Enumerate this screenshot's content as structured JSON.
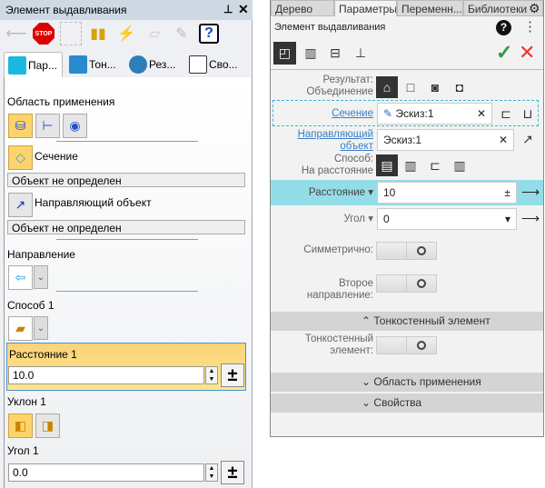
{
  "left_panel": {
    "title": "Элемент выдавливания",
    "pin": "ᵖ",
    "close": "✕",
    "toolbar": [
      "back-icon",
      "stop-icon",
      "grid-icon",
      "model-icon",
      "lightning-icon",
      "sketch-icon",
      "edit-icon",
      "help-icon"
    ],
    "stop_label": "STOP",
    "help_label": "?",
    "tabs": [
      "Пар...",
      "Тон...",
      "Рез...",
      "Сво..."
    ],
    "scope_label": "Область применения",
    "section_label": "Сечение",
    "section_value": "Объект не определен",
    "guide_label": "Направляющий объект",
    "guide_value": "Объект не определен",
    "direction_label": "Направление",
    "method_label": "Способ 1",
    "distance_label": "Расстояние 1",
    "distance_value": "10.0",
    "draft_label": "Уклон 1",
    "angle_label": "Угол 1",
    "angle_value": "0.0",
    "plusminus": "±"
  },
  "right_panel": {
    "tabs": [
      "Дерево",
      "Параметры",
      "Переменн...",
      "Библиотеки"
    ],
    "title": "Элемент выдавливания",
    "help": "?",
    "ok": "✓",
    "cancel": "✕",
    "result_label": "Результат:",
    "result_value": "Объединение",
    "section_label": "Сечение",
    "section_value": "Эскиз:1",
    "guide_label_1": "Направляющий",
    "guide_label_2": "объект",
    "guide_value": "Эскиз:1",
    "method_label": "Способ:",
    "method_value": "На расстояние",
    "distance_label": "Расстояние",
    "distance_value": "10",
    "angle_label": "Угол",
    "angle_value": "0",
    "symmetric_label": "Симметрично:",
    "second_dir_label": "Второе направление:",
    "thinwall_header": "Тонкостенный элемент",
    "thinwall_label_1": "Тонкостенный",
    "thinwall_label_2": "элемент:",
    "scope_header": "Область применения",
    "props_header": "Свойства",
    "clear": "✕",
    "pm": "±",
    "arrow": "⟶",
    "accent": "#93dde8"
  }
}
